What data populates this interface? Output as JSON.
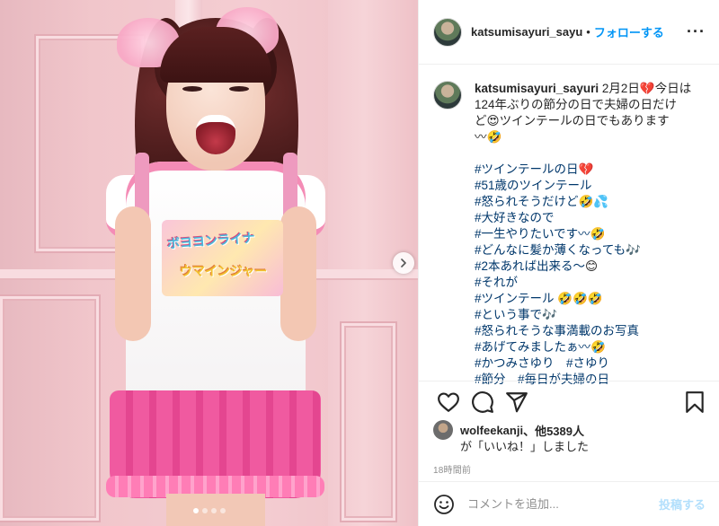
{
  "header": {
    "username": "katsumisayuri_sayu",
    "separator": "•",
    "follow_label": "フォローする",
    "more_label": "···"
  },
  "caption": {
    "username": "katsumisayuri_sayuri",
    "date": "2月2日",
    "text_lines": [
      "今日は",
      "124年ぶりの節分の日で夫婦の日だけ",
      "ど",
      "ツインテールの日でもあります",
      "〰"
    ],
    "emoji_heart": "💔",
    "emoji_heart_eyes": "😍",
    "emoji_laugh": "🤣",
    "emoji_sweat": "💦",
    "emoji_music": "🎶",
    "emoji_smile": "😊",
    "hashtags": {
      "t1": "#ツインテールの日",
      "t2": "#51歳のツインテール",
      "t3": "#怒られそうだけど",
      "t4": "#大好きなので",
      "t5": "#一生やりたいです〰",
      "t6": "#どんなに髪か薄くなっても",
      "t7": "#2本あれば出来る〜",
      "t8": "#それが",
      "t9": "#ツインテール",
      "t10": "#という事で",
      "t11": "#怒られそうな事満載のお写真",
      "t12": "#あげてみましたぁ〰",
      "t13a": "#かつみさゆり",
      "t13b": "#さゆり",
      "t14a": "#節分",
      "t14b": "#毎日が夫婦の日"
    }
  },
  "likes": {
    "user": "wolfeekanji",
    "others": "、他5389人",
    "line2": "が「いいね！」しました"
  },
  "timestamp": "18時間前",
  "comment": {
    "placeholder": "コメントを追加...",
    "post_label": "投稿する"
  },
  "photo": {
    "print_line1": "ボヨヨンライナ",
    "print_line2": "ウマインジャー"
  },
  "carousel": {
    "total": 4,
    "current": 1
  },
  "colors": {
    "accent": "#0095f6",
    "hashtag": "#00376b",
    "post_disabled": "#b2dffc",
    "muted": "#8e8e8e"
  }
}
